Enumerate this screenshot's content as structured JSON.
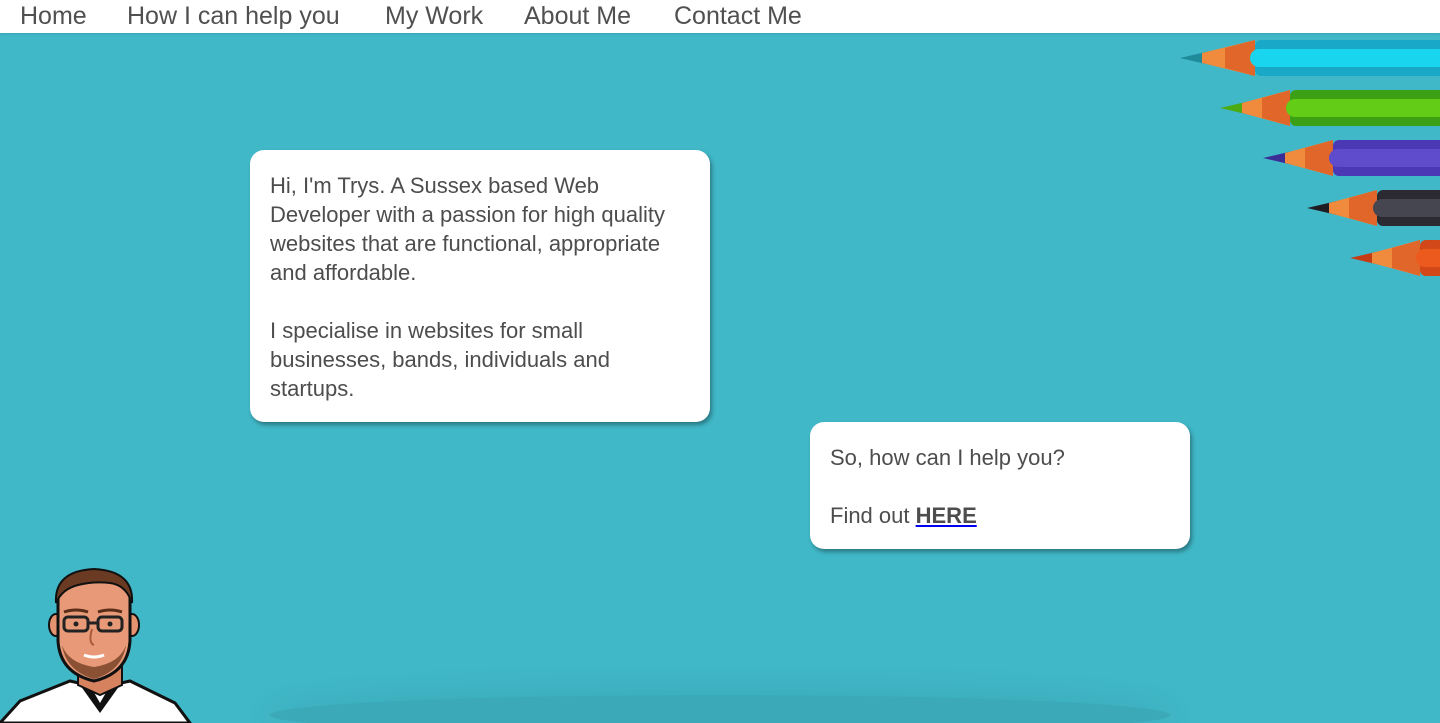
{
  "nav": {
    "items": [
      {
        "label": "Home"
      },
      {
        "label": "How I can help you"
      },
      {
        "label": "My Work"
      },
      {
        "label": "About Me"
      },
      {
        "label": "Contact Me"
      }
    ]
  },
  "intro": {
    "paragraph_1": "Hi, I'm Trys. A Sussex based Web Developer with a passion for high quality websites that are functional, appropriate and affordable.",
    "paragraph_2": "I specialise in websites for small businesses, bands, individuals and startups."
  },
  "cta": {
    "question": "So, how can I help you?",
    "find_out_prefix": "Find out",
    "here_link": "HERE"
  },
  "colors": {
    "background": "#40b8c8",
    "text": "#4d4d4d",
    "pencils": [
      "#19c8e6",
      "#5cc814",
      "#5a46c8",
      "#3c3c46",
      "#e6501e"
    ]
  }
}
